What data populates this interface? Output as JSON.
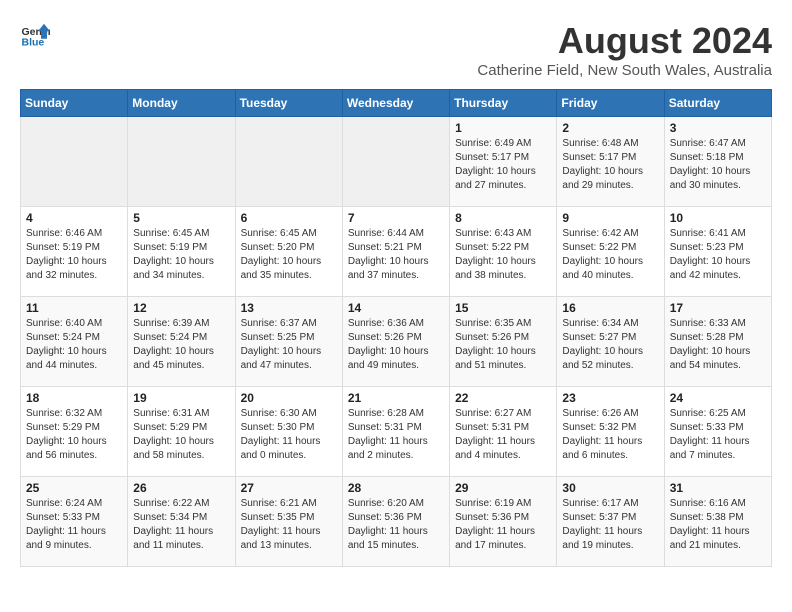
{
  "header": {
    "logo_general": "General",
    "logo_blue": "Blue",
    "title": "August 2024",
    "subtitle": "Catherine Field, New South Wales, Australia"
  },
  "days_of_week": [
    "Sunday",
    "Monday",
    "Tuesday",
    "Wednesday",
    "Thursday",
    "Friday",
    "Saturday"
  ],
  "weeks": [
    [
      {
        "day": "",
        "sunrise": "",
        "sunset": "",
        "daylight": "",
        "empty": true
      },
      {
        "day": "",
        "sunrise": "",
        "sunset": "",
        "daylight": "",
        "empty": true
      },
      {
        "day": "",
        "sunrise": "",
        "sunset": "",
        "daylight": "",
        "empty": true
      },
      {
        "day": "",
        "sunrise": "",
        "sunset": "",
        "daylight": "",
        "empty": true
      },
      {
        "day": "1",
        "sunrise": "Sunrise: 6:49 AM",
        "sunset": "Sunset: 5:17 PM",
        "daylight": "Daylight: 10 hours and 27 minutes.",
        "empty": false
      },
      {
        "day": "2",
        "sunrise": "Sunrise: 6:48 AM",
        "sunset": "Sunset: 5:17 PM",
        "daylight": "Daylight: 10 hours and 29 minutes.",
        "empty": false
      },
      {
        "day": "3",
        "sunrise": "Sunrise: 6:47 AM",
        "sunset": "Sunset: 5:18 PM",
        "daylight": "Daylight: 10 hours and 30 minutes.",
        "empty": false
      }
    ],
    [
      {
        "day": "4",
        "sunrise": "Sunrise: 6:46 AM",
        "sunset": "Sunset: 5:19 PM",
        "daylight": "Daylight: 10 hours and 32 minutes.",
        "empty": false
      },
      {
        "day": "5",
        "sunrise": "Sunrise: 6:45 AM",
        "sunset": "Sunset: 5:19 PM",
        "daylight": "Daylight: 10 hours and 34 minutes.",
        "empty": false
      },
      {
        "day": "6",
        "sunrise": "Sunrise: 6:45 AM",
        "sunset": "Sunset: 5:20 PM",
        "daylight": "Daylight: 10 hours and 35 minutes.",
        "empty": false
      },
      {
        "day": "7",
        "sunrise": "Sunrise: 6:44 AM",
        "sunset": "Sunset: 5:21 PM",
        "daylight": "Daylight: 10 hours and 37 minutes.",
        "empty": false
      },
      {
        "day": "8",
        "sunrise": "Sunrise: 6:43 AM",
        "sunset": "Sunset: 5:22 PM",
        "daylight": "Daylight: 10 hours and 38 minutes.",
        "empty": false
      },
      {
        "day": "9",
        "sunrise": "Sunrise: 6:42 AM",
        "sunset": "Sunset: 5:22 PM",
        "daylight": "Daylight: 10 hours and 40 minutes.",
        "empty": false
      },
      {
        "day": "10",
        "sunrise": "Sunrise: 6:41 AM",
        "sunset": "Sunset: 5:23 PM",
        "daylight": "Daylight: 10 hours and 42 minutes.",
        "empty": false
      }
    ],
    [
      {
        "day": "11",
        "sunrise": "Sunrise: 6:40 AM",
        "sunset": "Sunset: 5:24 PM",
        "daylight": "Daylight: 10 hours and 44 minutes.",
        "empty": false
      },
      {
        "day": "12",
        "sunrise": "Sunrise: 6:39 AM",
        "sunset": "Sunset: 5:24 PM",
        "daylight": "Daylight: 10 hours and 45 minutes.",
        "empty": false
      },
      {
        "day": "13",
        "sunrise": "Sunrise: 6:37 AM",
        "sunset": "Sunset: 5:25 PM",
        "daylight": "Daylight: 10 hours and 47 minutes.",
        "empty": false
      },
      {
        "day": "14",
        "sunrise": "Sunrise: 6:36 AM",
        "sunset": "Sunset: 5:26 PM",
        "daylight": "Daylight: 10 hours and 49 minutes.",
        "empty": false
      },
      {
        "day": "15",
        "sunrise": "Sunrise: 6:35 AM",
        "sunset": "Sunset: 5:26 PM",
        "daylight": "Daylight: 10 hours and 51 minutes.",
        "empty": false
      },
      {
        "day": "16",
        "sunrise": "Sunrise: 6:34 AM",
        "sunset": "Sunset: 5:27 PM",
        "daylight": "Daylight: 10 hours and 52 minutes.",
        "empty": false
      },
      {
        "day": "17",
        "sunrise": "Sunrise: 6:33 AM",
        "sunset": "Sunset: 5:28 PM",
        "daylight": "Daylight: 10 hours and 54 minutes.",
        "empty": false
      }
    ],
    [
      {
        "day": "18",
        "sunrise": "Sunrise: 6:32 AM",
        "sunset": "Sunset: 5:29 PM",
        "daylight": "Daylight: 10 hours and 56 minutes.",
        "empty": false
      },
      {
        "day": "19",
        "sunrise": "Sunrise: 6:31 AM",
        "sunset": "Sunset: 5:29 PM",
        "daylight": "Daylight: 10 hours and 58 minutes.",
        "empty": false
      },
      {
        "day": "20",
        "sunrise": "Sunrise: 6:30 AM",
        "sunset": "Sunset: 5:30 PM",
        "daylight": "Daylight: 11 hours and 0 minutes.",
        "empty": false
      },
      {
        "day": "21",
        "sunrise": "Sunrise: 6:28 AM",
        "sunset": "Sunset: 5:31 PM",
        "daylight": "Daylight: 11 hours and 2 minutes.",
        "empty": false
      },
      {
        "day": "22",
        "sunrise": "Sunrise: 6:27 AM",
        "sunset": "Sunset: 5:31 PM",
        "daylight": "Daylight: 11 hours and 4 minutes.",
        "empty": false
      },
      {
        "day": "23",
        "sunrise": "Sunrise: 6:26 AM",
        "sunset": "Sunset: 5:32 PM",
        "daylight": "Daylight: 11 hours and 6 minutes.",
        "empty": false
      },
      {
        "day": "24",
        "sunrise": "Sunrise: 6:25 AM",
        "sunset": "Sunset: 5:33 PM",
        "daylight": "Daylight: 11 hours and 7 minutes.",
        "empty": false
      }
    ],
    [
      {
        "day": "25",
        "sunrise": "Sunrise: 6:24 AM",
        "sunset": "Sunset: 5:33 PM",
        "daylight": "Daylight: 11 hours and 9 minutes.",
        "empty": false
      },
      {
        "day": "26",
        "sunrise": "Sunrise: 6:22 AM",
        "sunset": "Sunset: 5:34 PM",
        "daylight": "Daylight: 11 hours and 11 minutes.",
        "empty": false
      },
      {
        "day": "27",
        "sunrise": "Sunrise: 6:21 AM",
        "sunset": "Sunset: 5:35 PM",
        "daylight": "Daylight: 11 hours and 13 minutes.",
        "empty": false
      },
      {
        "day": "28",
        "sunrise": "Sunrise: 6:20 AM",
        "sunset": "Sunset: 5:36 PM",
        "daylight": "Daylight: 11 hours and 15 minutes.",
        "empty": false
      },
      {
        "day": "29",
        "sunrise": "Sunrise: 6:19 AM",
        "sunset": "Sunset: 5:36 PM",
        "daylight": "Daylight: 11 hours and 17 minutes.",
        "empty": false
      },
      {
        "day": "30",
        "sunrise": "Sunrise: 6:17 AM",
        "sunset": "Sunset: 5:37 PM",
        "daylight": "Daylight: 11 hours and 19 minutes.",
        "empty": false
      },
      {
        "day": "31",
        "sunrise": "Sunrise: 6:16 AM",
        "sunset": "Sunset: 5:38 PM",
        "daylight": "Daylight: 11 hours and 21 minutes.",
        "empty": false
      }
    ]
  ]
}
